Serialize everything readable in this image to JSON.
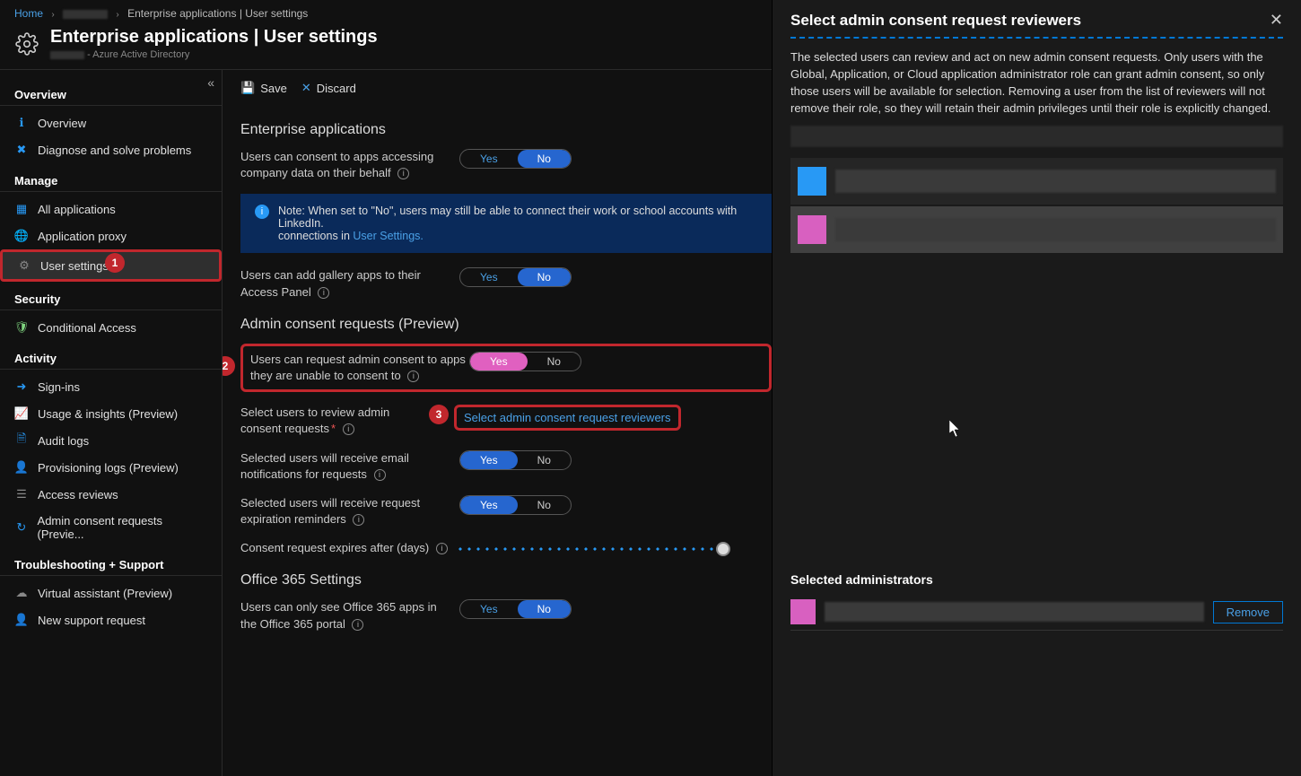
{
  "breadcrumb": {
    "home": "Home",
    "blank": "",
    "current": "Enterprise applications | User settings"
  },
  "header": {
    "title": "Enterprise applications | User settings",
    "subtitle": "- Azure Active Directory"
  },
  "sidebar": {
    "overview_section": "Overview",
    "overview": "Overview",
    "diagnose": "Diagnose and solve problems",
    "manage_section": "Manage",
    "all_apps": "All applications",
    "app_proxy": "Application proxy",
    "user_settings": "User settings",
    "security_section": "Security",
    "conditional": "Conditional Access",
    "activity_section": "Activity",
    "signins": "Sign-ins",
    "usage": "Usage & insights (Preview)",
    "audit": "Audit logs",
    "provisioning": "Provisioning logs (Preview)",
    "access": "Access reviews",
    "admin_consent": "Admin consent requests (Previe...",
    "troubleshoot_section": "Troubleshooting + Support",
    "virtual": "Virtual assistant (Preview)",
    "support": "New support request"
  },
  "toolbar": {
    "save": "Save",
    "discard": "Discard"
  },
  "main": {
    "section_enterprise": "Enterprise applications",
    "consent_apps": "Users can consent to apps accessing company data on their behalf",
    "info_note_prefix": "Note: When set to \"No\", users may still be able to connect their work or school accounts with LinkedIn.",
    "info_note_link_prefix": "connections in ",
    "info_note_link": "User Settings.",
    "gallery_apps": "Users can add gallery apps to their Access Panel",
    "section_admin": "Admin consent requests (Preview)",
    "request_consent": "Users can request admin consent to apps they are unable to consent to",
    "select_reviewers_label": "Select users to review admin consent requests",
    "select_reviewers_link": "Select admin consent request reviewers",
    "email_notif": "Selected users will receive email notifications for requests",
    "expire_reminders": "Selected users will receive request expiration reminders",
    "expires_after": "Consent request expires after (days)",
    "section_office": "Office 365 Settings",
    "office_only": "Users can only see Office 365 apps in the Office 365 portal"
  },
  "toggle": {
    "yes": "Yes",
    "no": "No"
  },
  "annotations": {
    "b1": "1",
    "b2": "2",
    "b3": "3"
  },
  "panel": {
    "title": "Select admin consent request reviewers",
    "desc": "The selected users can review and act on new admin consent requests. Only users with the Global, Application, or Cloud application administrator role can grant admin consent, so only those users will be available for selection. Removing a user from the list of reviewers will not remove their role, so they will retain their admin privileges until their role is explicitly changed.",
    "selected_section": "Selected administrators",
    "remove": "Remove"
  }
}
